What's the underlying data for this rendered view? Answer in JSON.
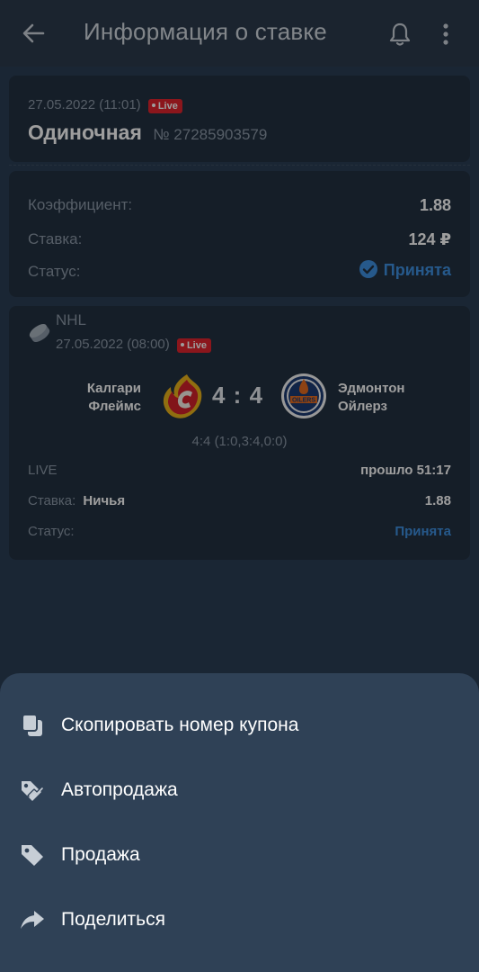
{
  "header": {
    "title": "Информация о ставке"
  },
  "bet": {
    "date": "27.05.2022 (11:01)",
    "live_label": "Live",
    "type": "Одиночная",
    "number": "№ 27285903579",
    "coef_label": "Коэффициент:",
    "coef_value": "1.88",
    "stake_label": "Ставка:",
    "stake_value": "124 ₽",
    "status_label": "Статус:",
    "status_value": "Принята"
  },
  "event": {
    "league": "NHL",
    "date": "27.05.2022 (08:00)",
    "live_label": "Live",
    "team_home_line1": "Калгари",
    "team_home_line2": "Флеймс",
    "score": "4 : 4",
    "team_away_line1": "Эдмонтон",
    "team_away_line2": "Ойлерз",
    "periods": "4:4 (1:0,3:4,0:0)",
    "live_text": "LIVE",
    "elapsed": "прошло 51:17",
    "stake_label": "Ставка:",
    "pick": "Ничья",
    "pick_coef": "1.88",
    "status_label": "Статус:",
    "status_value": "Принята"
  },
  "sheet": {
    "items": [
      {
        "label": "Скопировать номер купона",
        "icon": "copy-icon"
      },
      {
        "label": "Автопродажа",
        "icon": "autosell-icon"
      },
      {
        "label": "Продажа",
        "icon": "tag-icon"
      },
      {
        "label": "Поделиться",
        "icon": "share-icon"
      }
    ]
  },
  "colors": {
    "background": "#1a2634",
    "card": "#223040",
    "sheet": "#2f4156",
    "accent": "#3d8fe0",
    "live": "#e0242d"
  }
}
